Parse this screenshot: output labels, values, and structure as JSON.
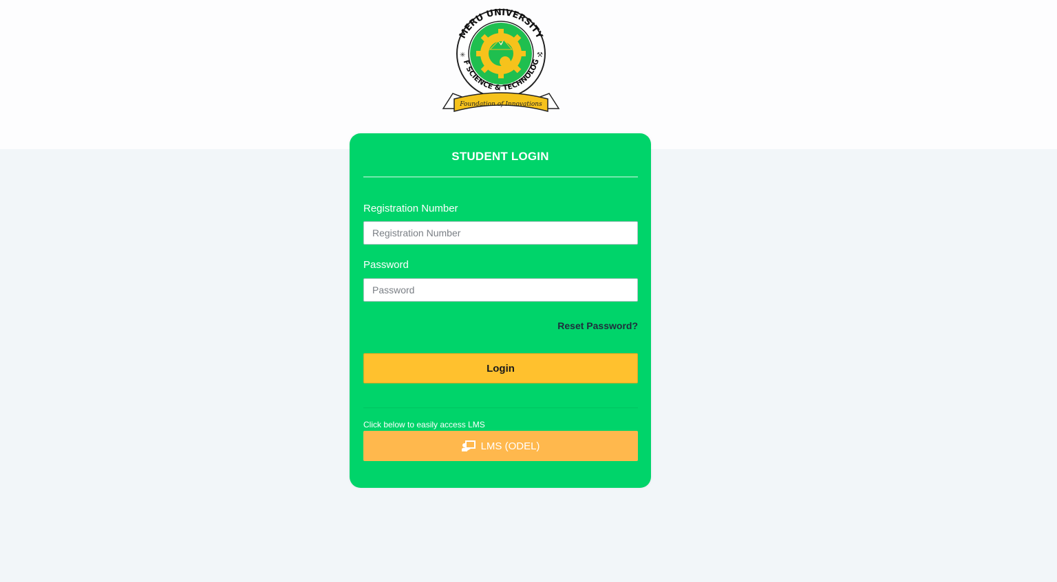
{
  "logo": {
    "name": "Meru University of Science & Technology",
    "motto": "Foundation of Innovations",
    "colors": {
      "green": "#1fbf4f",
      "yellow": "#f6c21c"
    }
  },
  "login_card": {
    "title": "STUDENT LOGIN",
    "registration": {
      "label": "Registration Number",
      "placeholder": "Registration Number",
      "value": ""
    },
    "password": {
      "label": "Password",
      "placeholder": "Password",
      "value": ""
    },
    "reset_link": "Reset Password?",
    "login_button": "Login",
    "lms_hint": "Click below to easily access LMS",
    "lms_button": "LMS (ODEL)",
    "lms_icon": "chalkboard-teacher-icon"
  },
  "colors": {
    "card_bg": "#00d46a",
    "login_button": "#ffc12e",
    "lms_button": "#ffb84d",
    "page_bg": "#f2f6f9"
  }
}
